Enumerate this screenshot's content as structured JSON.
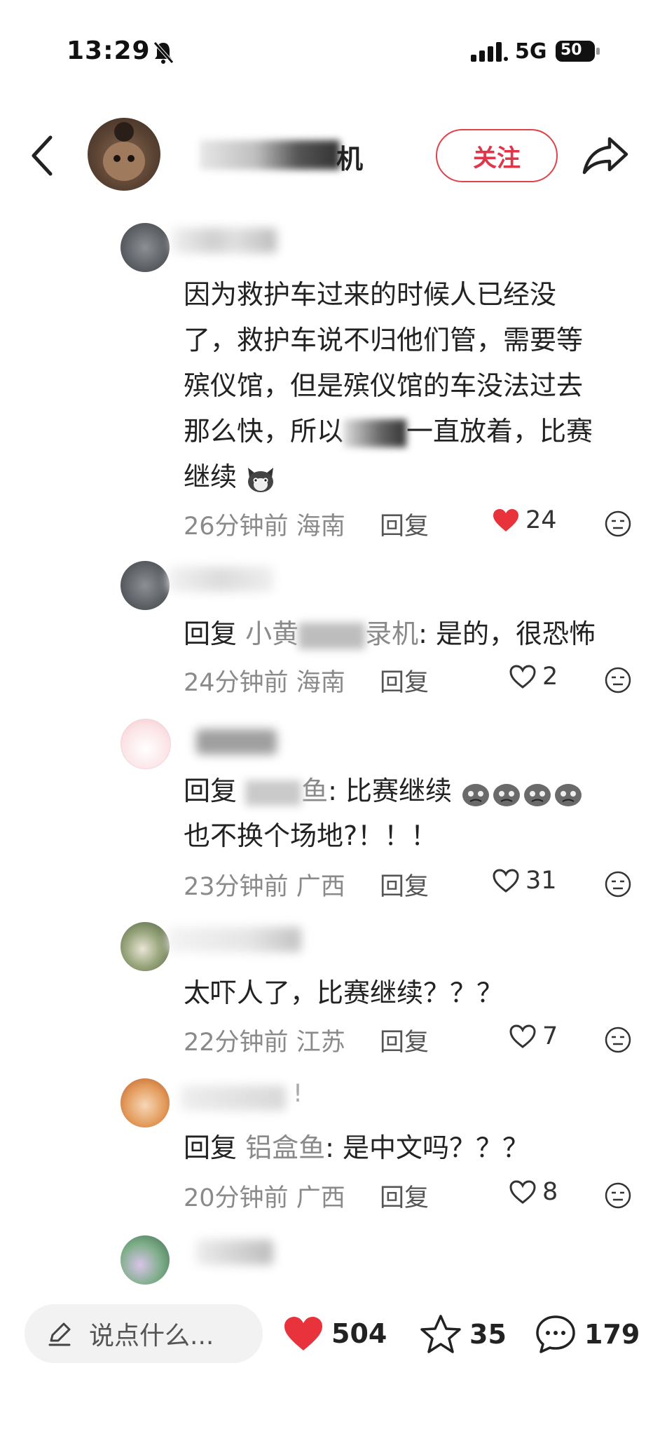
{
  "status_bar": {
    "time": "13:29",
    "network": "5G",
    "battery": "50"
  },
  "header": {
    "author_name_visible": "机",
    "follow_label": "关注"
  },
  "comments": [
    {
      "text_lines": [
        "因为救护车过来的时候人已经没",
        "了，救护车说不归他们管，需要等",
        "殡仪馆，但是殡仪馆的车没法过去",
        "那么快，所以",
        "一直放着，比赛",
        "继续"
      ],
      "time": "26分钟前",
      "region": "海南",
      "reply_label": "回复",
      "likes": "24",
      "liked": true
    },
    {
      "prefix": "回复",
      "reply_name_start": "小黄",
      "reply_name_end": "录机",
      "text": ": 是的，很恐怖",
      "time": "24分钟前",
      "region": "海南",
      "reply_label": "回复",
      "likes": "2",
      "liked": false
    },
    {
      "prefix": "回复",
      "reply_name_end": "鱼",
      "text": ": 比赛继续",
      "text_line2": "也不换个场地?！！！",
      "time": "23分钟前",
      "region": "广西",
      "reply_label": "回复",
      "likes": "31",
      "liked": false
    },
    {
      "text": "太吓人了，比赛继续？？？",
      "time": "22分钟前",
      "region": "江苏",
      "reply_label": "回复",
      "likes": "7",
      "liked": false
    },
    {
      "name_tail": "!",
      "prefix": "回复",
      "reply_name": "铝盒鱼",
      "text": ": 是中文吗？？？",
      "time": "20分钟前",
      "region": "广西",
      "reply_label": "回复",
      "likes": "8",
      "liked": false
    }
  ],
  "bottom_bar": {
    "input_placeholder": "说点什么...",
    "likes": "504",
    "favorites": "35",
    "comments": "179"
  },
  "colors": {
    "accent_red": "#e8323c",
    "meta_gray": "#8a8a8a"
  },
  "icons": [
    "bell-muted-icon",
    "signal-icon",
    "battery-icon",
    "back-icon",
    "share-icon",
    "heart-icon",
    "star-icon",
    "comment-icon",
    "pencil-icon",
    "dislike-face-icon"
  ]
}
